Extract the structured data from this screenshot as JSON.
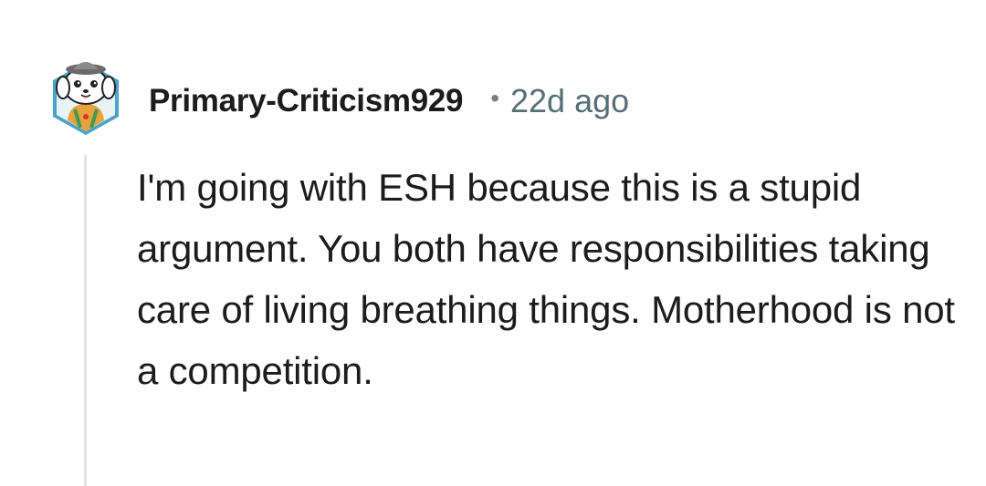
{
  "comment": {
    "avatar_icon": "snoo-dog-avatar-icon",
    "username": "Primary-Criticism929",
    "separator": "•",
    "timestamp": "22d ago",
    "body": "I'm going with ESH because this is a stupid argument. You both have responsibilities taking care of living breathing things. Motherhood is not a competition."
  },
  "colors": {
    "username": "#1c1c1c",
    "timestamp": "#576f76",
    "thread_line": "#e3e3e3",
    "body_text": "#1c1c1c",
    "background": "#ffffff"
  }
}
